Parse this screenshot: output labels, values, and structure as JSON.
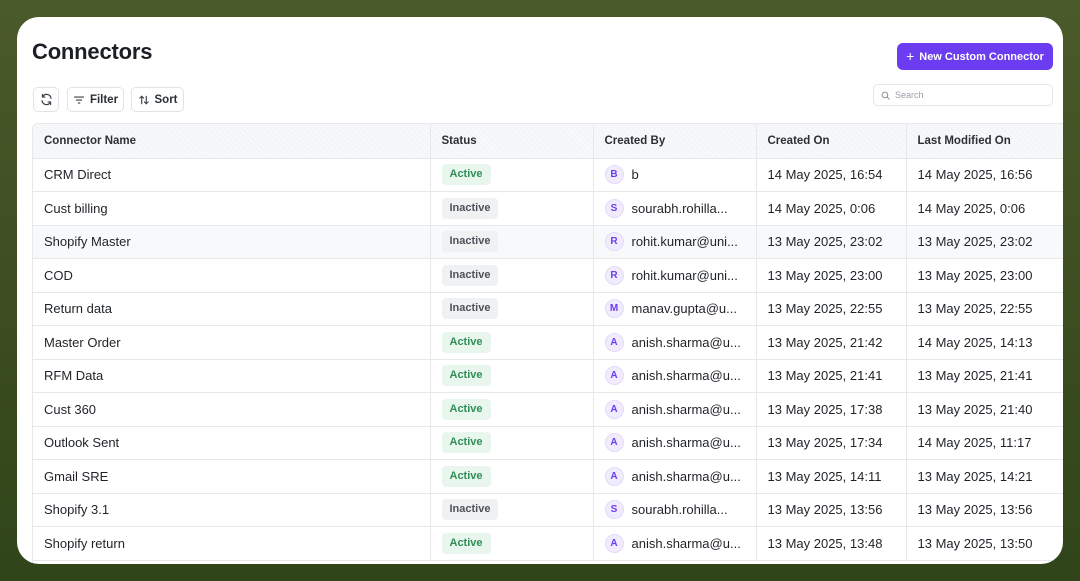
{
  "page": {
    "title": "Connectors"
  },
  "actions": {
    "new_connector_label": "New Custom Connector"
  },
  "toolbar": {
    "filter_label": "Filter",
    "sort_label": "Sort"
  },
  "search": {
    "placeholder": "Search"
  },
  "colors": {
    "accent": "#6c3df0",
    "active_text": "#2f8f55",
    "active_bg": "#e8f6ee",
    "inactive_bg": "#f0f1f3"
  },
  "table": {
    "columns": [
      "Connector Name",
      "Status",
      "Created By",
      "Created On",
      "Last Modified On"
    ],
    "rows": [
      {
        "name": "CRM Direct",
        "status": "Active",
        "initial": "B",
        "created_by": "b",
        "created_on": "14 May 2025, 16:54",
        "modified_on": "14 May 2025, 16:56"
      },
      {
        "name": "Cust billing",
        "status": "Inactive",
        "initial": "S",
        "created_by": "sourabh.rohilla...",
        "created_on": "14 May 2025, 0:06",
        "modified_on": "14 May 2025, 0:06"
      },
      {
        "name": "Shopify Master",
        "status": "Inactive",
        "initial": "R",
        "created_by": "rohit.kumar@uni...",
        "created_on": "13 May 2025, 23:02",
        "modified_on": "13 May 2025, 23:02"
      },
      {
        "name": "COD",
        "status": "Inactive",
        "initial": "R",
        "created_by": "rohit.kumar@uni...",
        "created_on": "13 May 2025, 23:00",
        "modified_on": "13 May 2025, 23:00"
      },
      {
        "name": "Return data",
        "status": "Inactive",
        "initial": "M",
        "created_by": "manav.gupta@u...",
        "created_on": "13 May 2025, 22:55",
        "modified_on": "13 May 2025, 22:55"
      },
      {
        "name": "Master Order",
        "status": "Active",
        "initial": "A",
        "created_by": "anish.sharma@u...",
        "created_on": "13 May 2025, 21:42",
        "modified_on": "14 May 2025, 14:13"
      },
      {
        "name": "RFM Data",
        "status": "Active",
        "initial": "A",
        "created_by": "anish.sharma@u...",
        "created_on": "13 May 2025, 21:41",
        "modified_on": "13 May 2025, 21:41"
      },
      {
        "name": "Cust 360",
        "status": "Active",
        "initial": "A",
        "created_by": "anish.sharma@u...",
        "created_on": "13 May 2025, 17:38",
        "modified_on": "13 May 2025, 21:40"
      },
      {
        "name": "Outlook Sent",
        "status": "Active",
        "initial": "A",
        "created_by": "anish.sharma@u...",
        "created_on": "13 May 2025, 17:34",
        "modified_on": "14 May 2025, 11:17"
      },
      {
        "name": "Gmail SRE",
        "status": "Active",
        "initial": "A",
        "created_by": "anish.sharma@u...",
        "created_on": "13 May 2025, 14:11",
        "modified_on": "13 May 2025, 14:21"
      },
      {
        "name": "Shopify 3.1",
        "status": "Inactive",
        "initial": "S",
        "created_by": "sourabh.rohilla...",
        "created_on": "13 May 2025, 13:56",
        "modified_on": "13 May 2025, 13:56"
      },
      {
        "name": "Shopify return",
        "status": "Active",
        "initial": "A",
        "created_by": "anish.sharma@u...",
        "created_on": "13 May 2025, 13:48",
        "modified_on": "13 May 2025, 13:50"
      }
    ]
  }
}
